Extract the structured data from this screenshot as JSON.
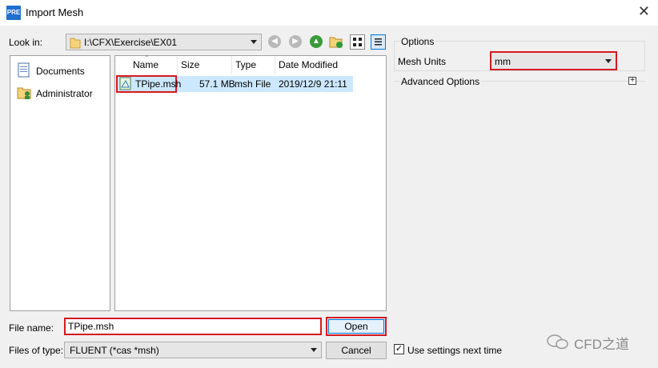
{
  "window": {
    "icon_text": "PRE",
    "title": "Import Mesh",
    "close_glyph": "✕"
  },
  "look_in": {
    "label": "Look in:",
    "path": "I:\\CFX\\Exercise\\EX01"
  },
  "sidebar": {
    "items": [
      {
        "label": "Documents",
        "icon": "documents-icon"
      },
      {
        "label": "Administrator",
        "icon": "user-folder-icon"
      }
    ]
  },
  "file_list": {
    "columns": [
      "Name",
      "Size",
      "Type",
      "Date Modified"
    ],
    "rows": [
      {
        "name": "TPipe.msh",
        "size": "57.1 MB",
        "type": "msh File",
        "date": "2019/12/9 21:11"
      }
    ]
  },
  "file_name": {
    "label": "File name:",
    "value": "TPipe.msh"
  },
  "file_type": {
    "label": "Files of type:",
    "value": "FLUENT (*cas *msh)"
  },
  "buttons": {
    "open": "Open",
    "cancel": "Cancel"
  },
  "options": {
    "header": "Options",
    "mesh_units_label": "Mesh Units",
    "mesh_units_value": "mm",
    "advanced_label": "Advanced Options",
    "expand_glyph": "+"
  },
  "use_settings": {
    "label": "Use settings next time",
    "checked": true,
    "check_glyph": "✓"
  },
  "watermark": {
    "text": "CFD之道"
  },
  "colors": {
    "highlight_red": "#d6191f",
    "selection_blue": "#cce8ff",
    "focus_blue": "#0078d7"
  }
}
